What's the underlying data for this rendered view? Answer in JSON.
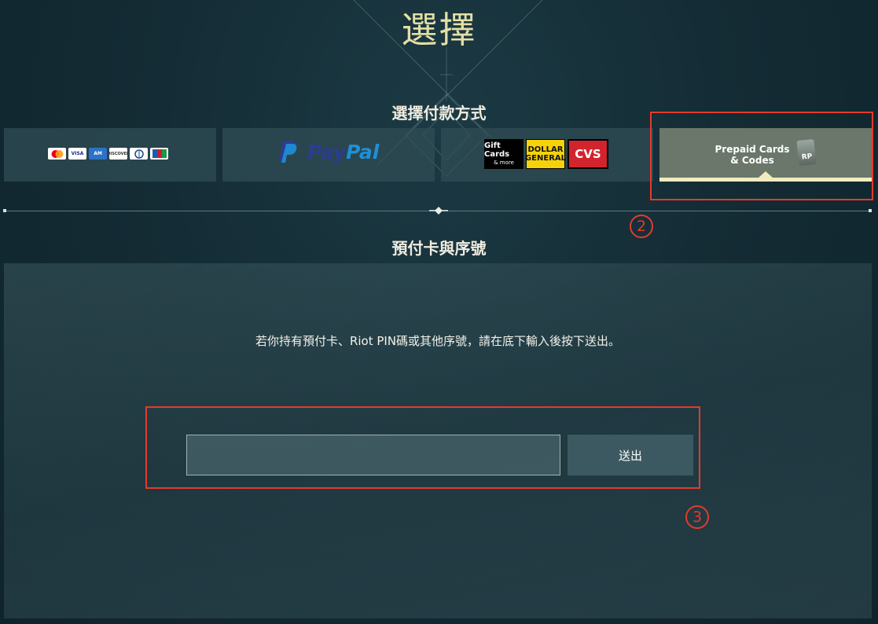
{
  "header": {
    "title": "選擇",
    "subtitle": "選擇付款方式"
  },
  "payment_methods": [
    {
      "id": "cards",
      "card_brands": [
        "MC",
        "VISA",
        "AMEX",
        "DISCOVER",
        "Diners",
        "JCB"
      ],
      "active": false
    },
    {
      "id": "paypal",
      "label_part1": "Pay",
      "label_part2": "Pal",
      "active": false
    },
    {
      "id": "gift",
      "gift_line1": "Gift Cards",
      "gift_line2": "& more",
      "dollar_line1": "DOLLAR",
      "dollar_line2": "GENERAL",
      "cvs": "CVS",
      "active": false
    },
    {
      "id": "prepaid",
      "label_line1": "Prepaid Cards",
      "label_line2": "& Codes",
      "rp": "RP",
      "active": true
    }
  ],
  "section": {
    "title": "預付卡與序號",
    "instruction": "若你持有預付卡、Riot PIN碼或其他序號，請在底下輸入後按下送出。",
    "code_input": {
      "value": "",
      "placeholder": ""
    },
    "submit_label": "送出"
  },
  "annotations": {
    "box2_number": "2",
    "box3_number": "3",
    "color": "#e53a2c"
  }
}
